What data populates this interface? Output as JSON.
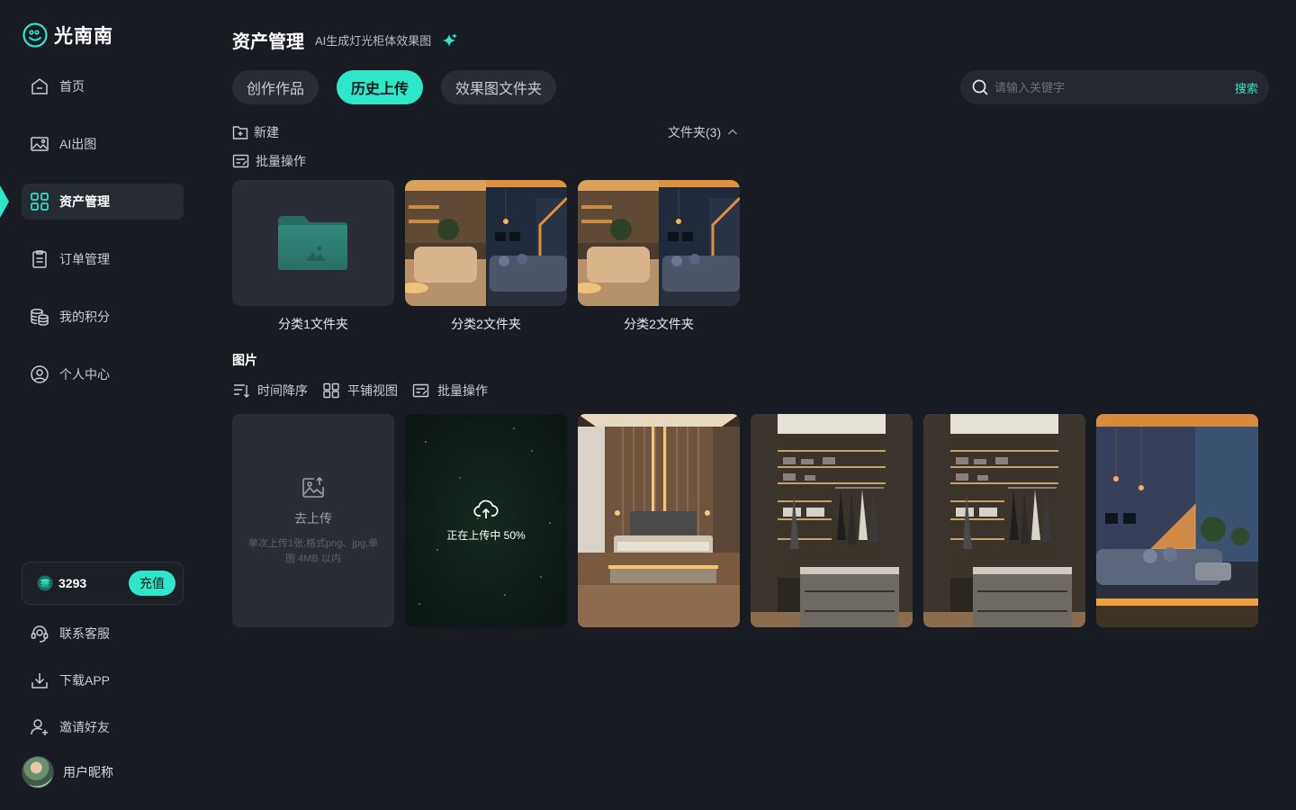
{
  "brand": {
    "name": "光南南",
    "accent": "#2ee6c8"
  },
  "sidebar": {
    "items": [
      {
        "label": "首页",
        "icon": "home-icon",
        "active": false
      },
      {
        "label": "AI出图",
        "icon": "image-icon",
        "active": false
      },
      {
        "label": "资产管理",
        "icon": "grid-icon",
        "active": true
      },
      {
        "label": "订单管理",
        "icon": "clipboard-icon",
        "active": false
      },
      {
        "label": "我的积分",
        "icon": "coins-icon",
        "active": false
      },
      {
        "label": "个人中心",
        "icon": "user-circle-icon",
        "active": false
      }
    ],
    "credits": {
      "value": "3293",
      "recharge_label": "充值"
    },
    "bottom_items": [
      {
        "label": "联系客服",
        "icon": "headset-icon"
      },
      {
        "label": "下载APP",
        "icon": "download-icon"
      },
      {
        "label": "邀请好友",
        "icon": "add-user-icon"
      }
    ],
    "user": {
      "name": "用户昵称"
    }
  },
  "header": {
    "title": "资产管理",
    "subtitle": "AI生成灯光柜体效果图"
  },
  "tabs": [
    {
      "label": "创作作品",
      "active": false
    },
    {
      "label": "历史上传",
      "active": true
    },
    {
      "label": "效果图文件夹",
      "active": false
    }
  ],
  "search": {
    "placeholder": "请输入关键字",
    "button_label": "搜索"
  },
  "folders_section": {
    "new_label": "新建",
    "batch_label": "批量操作",
    "count_label": "文件夹(3)",
    "folders": [
      {
        "name": "分类1文件夹",
        "thumb": "empty-folder"
      },
      {
        "name": "分类2文件夹",
        "thumb": "living-room"
      },
      {
        "name": "分类2文件夹",
        "thumb": "living-room"
      }
    ]
  },
  "images_section": {
    "label": "图片",
    "sort_label": "时间降序",
    "view_label": "平铺视图",
    "batch_label": "批量操作",
    "upload": {
      "label": "去上传",
      "hint": "单次上传1张,格式png、jpg,单图 4MB 以内"
    },
    "uploading": {
      "text": "正在上传中 50%",
      "progress": 0.5
    },
    "images": [
      "bedroom",
      "wardrobe",
      "wardrobe",
      "living-room-dusk"
    ]
  }
}
